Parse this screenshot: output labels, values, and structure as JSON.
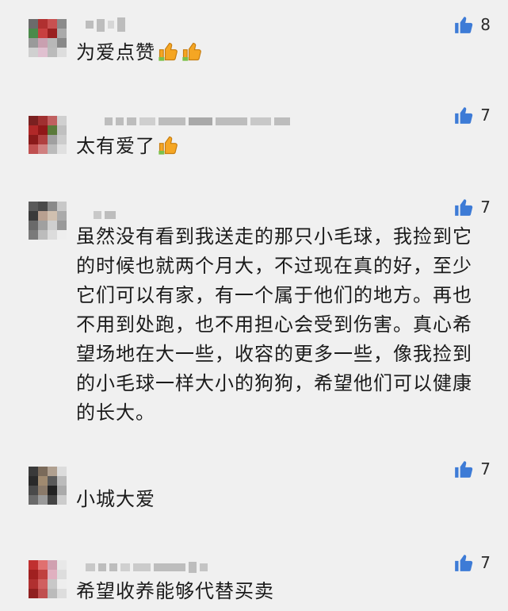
{
  "comments": [
    {
      "text": "为爱点赞",
      "likes": "8",
      "emoji": [
        "thumbs-up",
        "thumbs-up"
      ]
    },
    {
      "text": "太有爱了",
      "likes": "7",
      "emoji": [
        "thumbs-up"
      ]
    },
    {
      "text": "虽然没有看到我送走的那只小毛球，我捡到它的时候也就两个月大，不过现在真的好，至少它们可以有家，有一个属于他们的地方。再也不用到处跑，也不用担心会受到伤害。真心希望场地在大一些，收容的更多一些，像我捡到的小毛球一样大小的狗狗，希望他们可以健康的长大。",
      "likes": "7",
      "emoji": []
    },
    {
      "text": "小城大爱",
      "likes": "7",
      "emoji": []
    },
    {
      "text": "希望收养能够代替买卖",
      "likes": "7",
      "emoji": []
    }
  ],
  "colors": {
    "like_icon": "#3d7bd6",
    "emoji": "#f5a623",
    "background": "#f0f0f0"
  }
}
